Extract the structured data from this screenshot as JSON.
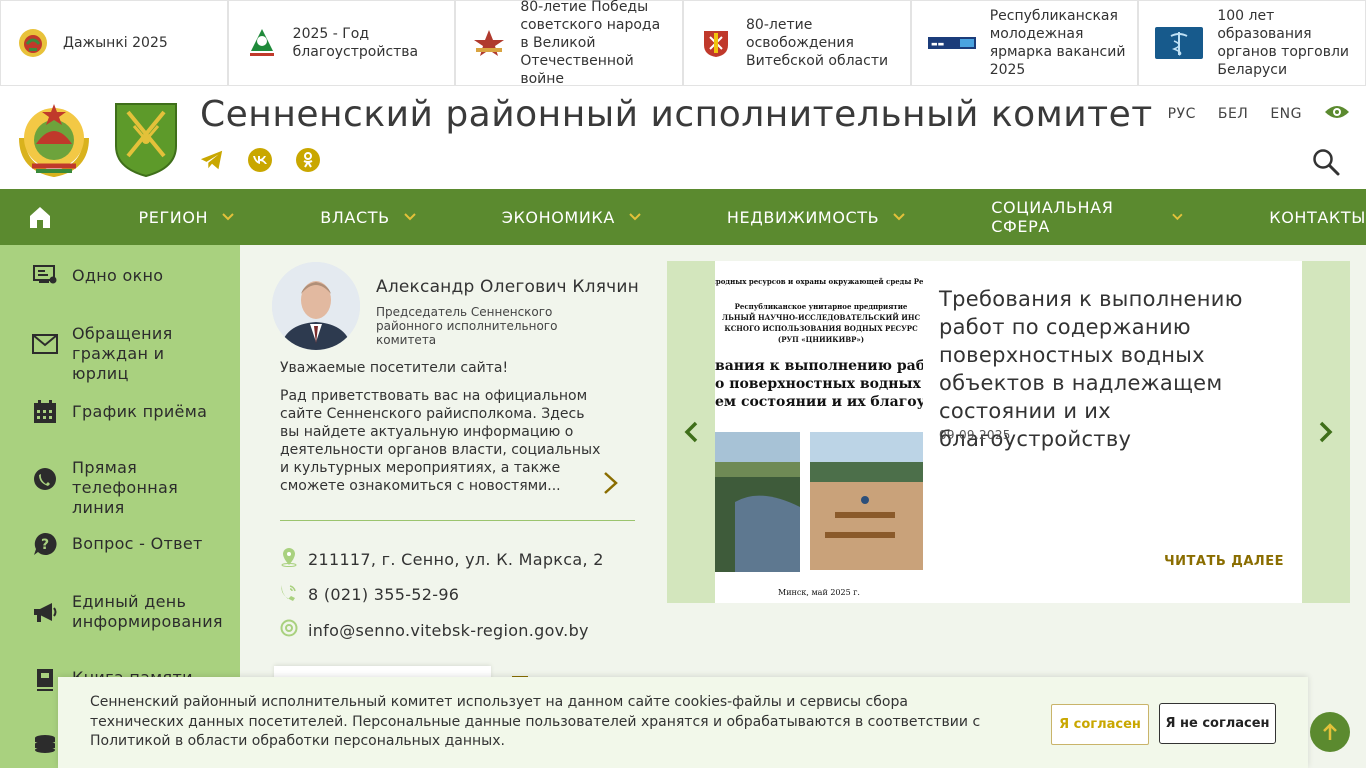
{
  "banners": [
    {
      "icon": "national-emblem-icon",
      "text": "Дажынкі 2025"
    },
    {
      "icon": "improvement-year-icon",
      "text": "2025 - Год благоустройства"
    },
    {
      "icon": "victory-star-icon",
      "text": "80-летие Победы советского народа в Великой Отечественной войне"
    },
    {
      "icon": "vitebsk-coat-icon",
      "text": "80-летие освобождения Витебской области"
    },
    {
      "icon": "job-fair-icon",
      "text": "Республиканская молодежная ярмарка вакансий 2025"
    },
    {
      "icon": "trade-caduceus-icon",
      "text": "100 лет образования органов торговли Беларуси"
    }
  ],
  "header": {
    "title": "Сенненский районный исполнительный комитет",
    "languages": [
      "РУС",
      "БЕЛ",
      "ENG"
    ],
    "socials": [
      "telegram-icon",
      "vk-icon",
      "odnoklassniki-icon"
    ]
  },
  "nav": {
    "items": [
      {
        "label": "РЕГИОН",
        "has_dropdown": true
      },
      {
        "label": "ВЛАСТЬ",
        "has_dropdown": true
      },
      {
        "label": "ЭКОНОМИКА",
        "has_dropdown": true
      },
      {
        "label": "НЕДВИЖИМОСТЬ",
        "has_dropdown": true
      },
      {
        "label": "СОЦИАЛЬНАЯ СФЕРА",
        "has_dropdown": true
      },
      {
        "label": "КОНТАКТЫ",
        "has_dropdown": false
      }
    ]
  },
  "sidebar": {
    "items": [
      {
        "label": "Одно окно",
        "icon": "one-window-icon"
      },
      {
        "label": "Обращения граждан и юрлиц",
        "icon": "envelope-icon"
      },
      {
        "label": "График приёма",
        "icon": "calendar-icon"
      },
      {
        "label": "Прямая телефонная линия",
        "icon": "phone-hand-icon"
      },
      {
        "label": "Вопрос - Ответ",
        "icon": "question-icon"
      },
      {
        "label": "Единый день информирования",
        "icon": "megaphone-icon"
      },
      {
        "label": "Книга памяти",
        "icon": "book-icon"
      },
      {
        "label": "",
        "icon": "coins-icon"
      }
    ]
  },
  "chairman": {
    "name": "Александр Олегович Клячин",
    "role": "Председатель Сенненского районного исполнительного комитета",
    "greeting_title": "Уважаемые посетители сайта!",
    "greeting_text": "Рад приветствовать вас на официальном сайте Сенненского райисполкома. Здесь вы найдете актуальную информацию о деятельности органов власти, социальных и культурных мероприятиях, а также сможете ознакомиться с новостями..."
  },
  "contacts": {
    "address": "211117, г. Сенно, ул. К. Маркса, 2",
    "phone": "8 (021) 355-52-96",
    "email": "info@senno.vitebsk-region.gov.by"
  },
  "news": {
    "title": "Требования к выполнению работ по содержанию поверхностных водных объектов в надлежащем состоянии и их благоустройству",
    "date": "09.09.2025",
    "read_more": "ЧИТАТЬ ДАЛЕЕ",
    "image": {
      "ministry": "Министерство природных ресурсов и охраны окружающей среды Республики Беларусь",
      "org_line1": "Республиканское унитарное предприятие",
      "org_line2": "ЛЬНЫЙ НАУЧНО-ИССЛЕДОВАТЕЛЬСКИЙ ИНС",
      "org_line3": "КСНОГО ИСПОЛЬЗОВАНИЯ ВОДНЫХ РЕСУРС",
      "org_line4": "(РУП «ЦНИИКИВР»)",
      "doc_line1": "вания к выполнению рабо",
      "doc_line2": "о поверхностных водных о",
      "doc_line3": "ем состоянии и их благоус",
      "footer": "Минск, май 2025 г."
    }
  },
  "cookie": {
    "text": "Сенненский районный исполнительный комитет использует на данном сайте cookies-файлы и сервисы сбора технических данных посетителей. Персональные данные пользователей хранятся и обрабатываются в соответствии с Политикой в области обработки персональных данных.",
    "agree": "Я согласен",
    "disagree": "Я не согласен"
  },
  "colors": {
    "nav_green": "#5b8a2f",
    "sidebar_green": "#a9d17f",
    "accent_gold": "#c9a700",
    "read_more": "#8a6d00"
  }
}
